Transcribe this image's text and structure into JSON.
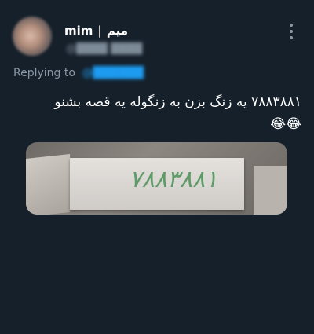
{
  "user": {
    "name": "mim",
    "name_fa": "میم",
    "separator": "|"
  },
  "reply": {
    "prefix": "Replying to"
  },
  "tweet": {
    "text": "۷۸۸۳۸۸۱ یه زنگ بزن به زنگوله یه قصه بشنو",
    "emojis": "😂😂"
  },
  "media": {
    "handwritten_number": "۷۸۸۳۸۸۱"
  },
  "colors": {
    "background": "#15202b",
    "link": "#1d9bf0",
    "secondary": "#8b98a5"
  },
  "icons": {
    "more": "more-vertical-icon"
  }
}
